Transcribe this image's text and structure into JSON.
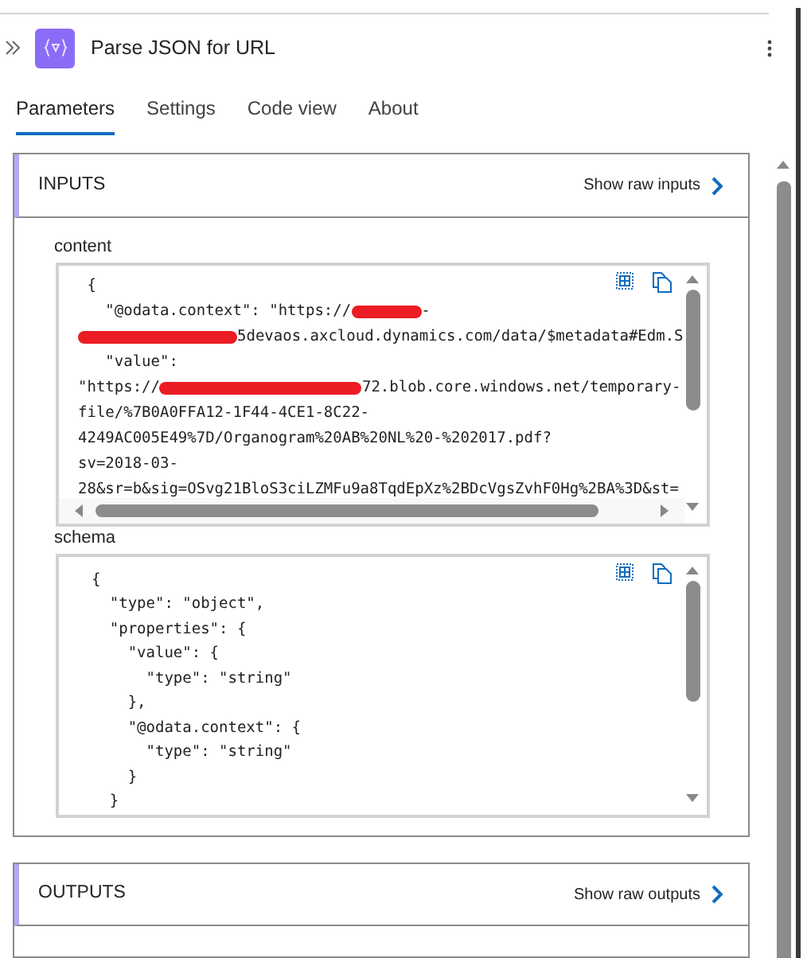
{
  "panel": {
    "title": "Parse JSON for URL"
  },
  "tabs": [
    {
      "label": "Parameters",
      "selected": true
    },
    {
      "label": "Settings",
      "selected": false
    },
    {
      "label": "Code view",
      "selected": false
    },
    {
      "label": "About",
      "selected": false
    }
  ],
  "inputs": {
    "heading": "INPUTS",
    "action": "Show raw inputs",
    "fields": [
      {
        "label": "content",
        "kind": "scrolling",
        "lines": [
          [
            {
              "kind": "text",
              "text": " {"
            }
          ],
          [
            {
              "kind": "text",
              "text": "   \"@odata.context\": \"https://"
            },
            {
              "kind": "redaction"
            },
            {
              "kind": "text",
              "text": "-"
            }
          ],
          [
            {
              "kind": "redaction"
            },
            {
              "kind": "text",
              "text": "5devaos.axcloud.dynamics.com/data/$metadata#Edm.S"
            }
          ],
          [
            {
              "kind": "text",
              "text": "   \"value\":"
            }
          ],
          [
            {
              "kind": "text",
              "text": "\"https://"
            },
            {
              "kind": "redaction"
            },
            {
              "kind": "text",
              "text": "72.blob.core.windows.net/temporary-"
            }
          ],
          [
            {
              "kind": "text",
              "text": "file/%7B0A0FFA12-1F44-4CE1-8C22-"
            }
          ],
          [
            {
              "kind": "text",
              "text": "4249AC005E49%7D/Organogram%20AB%20NL%20-%202017.pdf?"
            }
          ],
          [
            {
              "kind": "text",
              "text": "sv=2018-03-"
            }
          ],
          [
            {
              "kind": "text",
              "text": "28&sr=b&sig=OSvg21BloS3ciLZMFu9a8TqdEpXz%2BDcVgsZvhF0Hg%2BA%3D&st="
            }
          ]
        ]
      },
      {
        "label": "schema",
        "kind": "plain",
        "lines": [
          [
            {
              "kind": "text",
              "text": "  {"
            }
          ],
          [
            {
              "kind": "text",
              "text": "    \"type\": \"object\","
            }
          ],
          [
            {
              "kind": "text",
              "text": "    \"properties\": {"
            }
          ],
          [
            {
              "kind": "text",
              "text": "      \"value\": {"
            }
          ],
          [
            {
              "kind": "text",
              "text": "        \"type\": \"string\""
            }
          ],
          [
            {
              "kind": "text",
              "text": "      },"
            }
          ],
          [
            {
              "kind": "text",
              "text": "      \"@odata.context\": {"
            }
          ],
          [
            {
              "kind": "text",
              "text": "        \"type\": \"string\""
            }
          ],
          [
            {
              "kind": "text",
              "text": "      }"
            }
          ],
          [
            {
              "kind": "text",
              "text": "    }"
            }
          ]
        ]
      }
    ]
  },
  "outputs": {
    "heading": "OUTPUTS",
    "action": "Show raw outputs"
  }
}
